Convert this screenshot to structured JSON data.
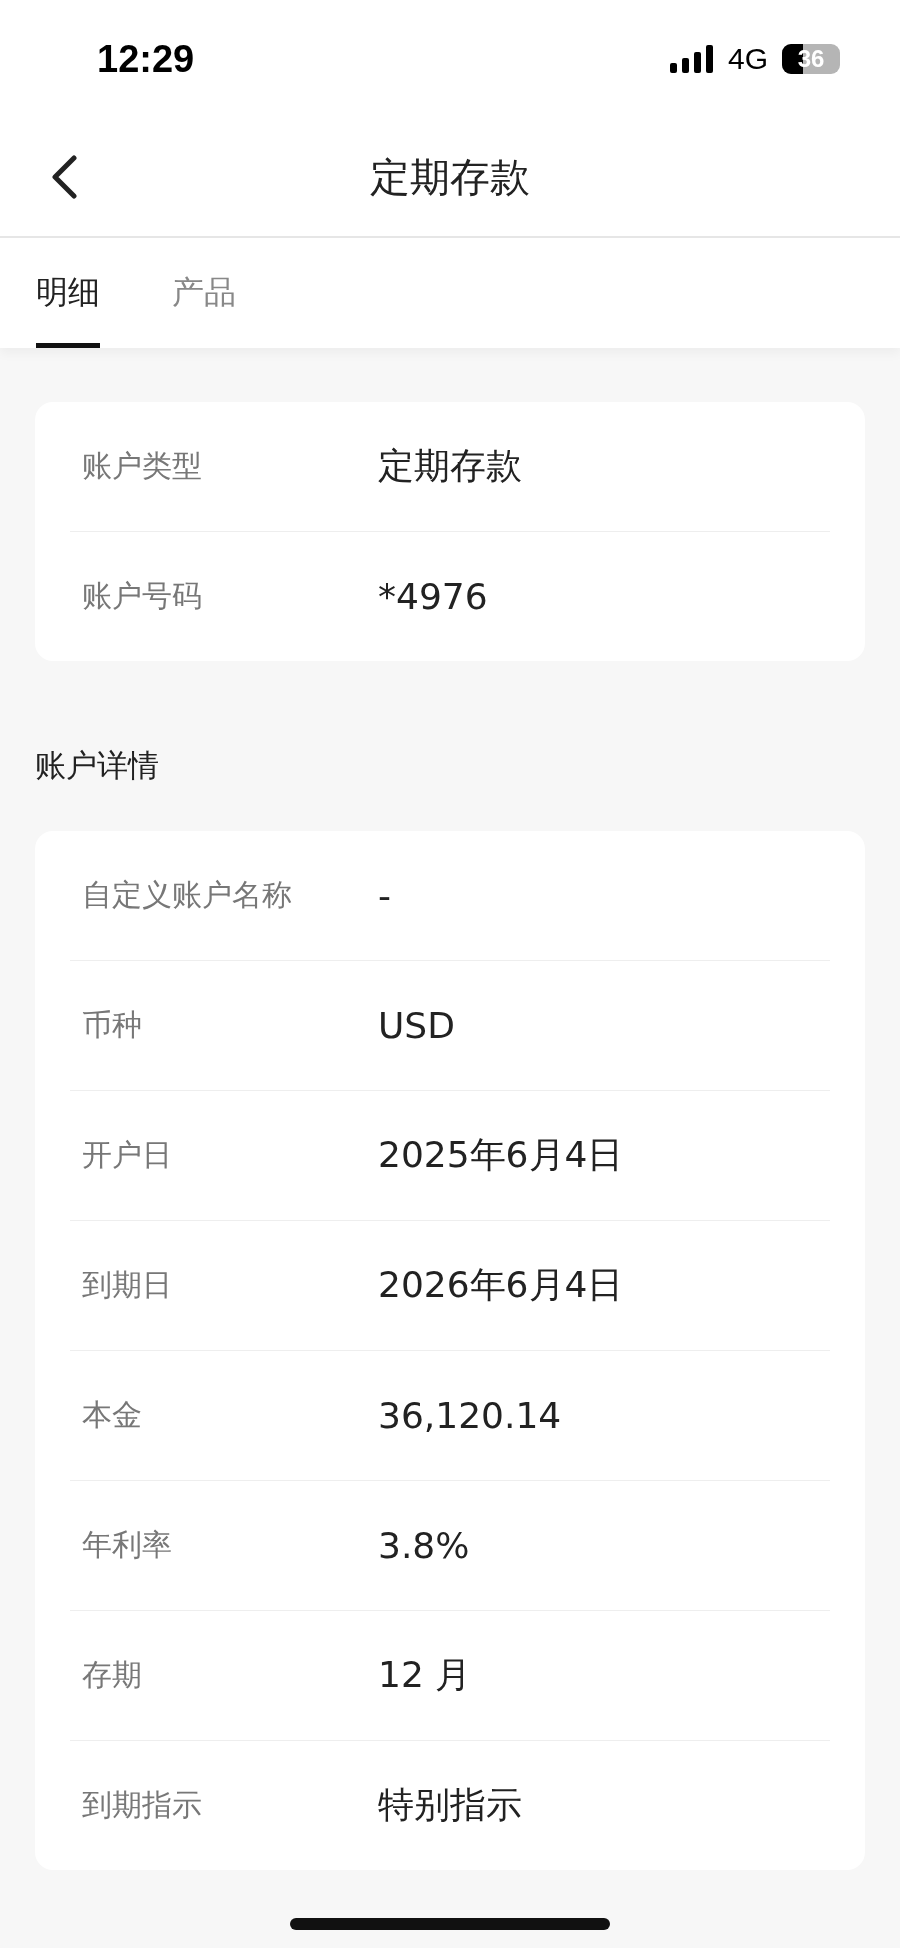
{
  "status_bar": {
    "time": "12:29",
    "network": "4G",
    "battery": {
      "text": "36",
      "level": 0.36
    }
  },
  "header": {
    "title": "定期存款"
  },
  "tabs": [
    {
      "label": "明细",
      "selected": true
    },
    {
      "label": "产品",
      "selected": false
    }
  ],
  "overview": {
    "rows": [
      {
        "label": "账户类型",
        "value": "定期存款"
      },
      {
        "label": "账户号码",
        "value": "*4976"
      }
    ]
  },
  "details": {
    "title": "账户详情",
    "rows": [
      {
        "label": "自定义账户名称",
        "value": "-"
      },
      {
        "label": "币种",
        "value": "USD"
      },
      {
        "label": "开户日",
        "value": "2025年6月4日"
      },
      {
        "label": "到期日",
        "value": "2026年6月4日"
      },
      {
        "label": "本金",
        "value": "36,120.14"
      },
      {
        "label": "年利率",
        "value": "3.8%"
      },
      {
        "label": "存期",
        "value": "12 月"
      },
      {
        "label": "到期指示",
        "value": "特别指示"
      }
    ]
  }
}
